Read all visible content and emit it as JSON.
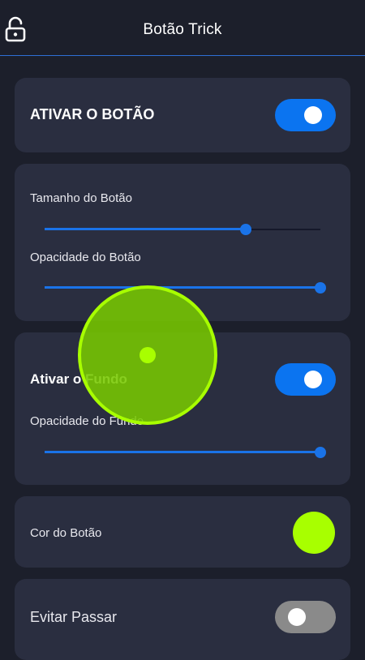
{
  "header": {
    "title": "Botão Trick",
    "lock_icon": "unlocked-padlock-icon"
  },
  "cards": {
    "activate_button": {
      "label": "ATIVAR O BOTÃO",
      "toggle_on": true
    },
    "size_opacity": {
      "size_label": "Tamanho do Botão",
      "size_value": 0.73,
      "opacity_label": "Opacidade do Botão",
      "opacity_value": 1.0
    },
    "background": {
      "label": "Ativar o Fundo",
      "toggle_on": true,
      "opacity_label": "Opacidade do Fundo",
      "opacity_value": 1.0
    },
    "color": {
      "label": "Cor do Botão",
      "color": "#a8ff00"
    },
    "avoid_passing": {
      "label": "Evitar Passar",
      "toggle_on": false
    }
  },
  "colors": {
    "accent": "#0b74f0",
    "card": "#2a2e40",
    "background": "#1c1f2b",
    "floating_button": "#a8ff00"
  }
}
